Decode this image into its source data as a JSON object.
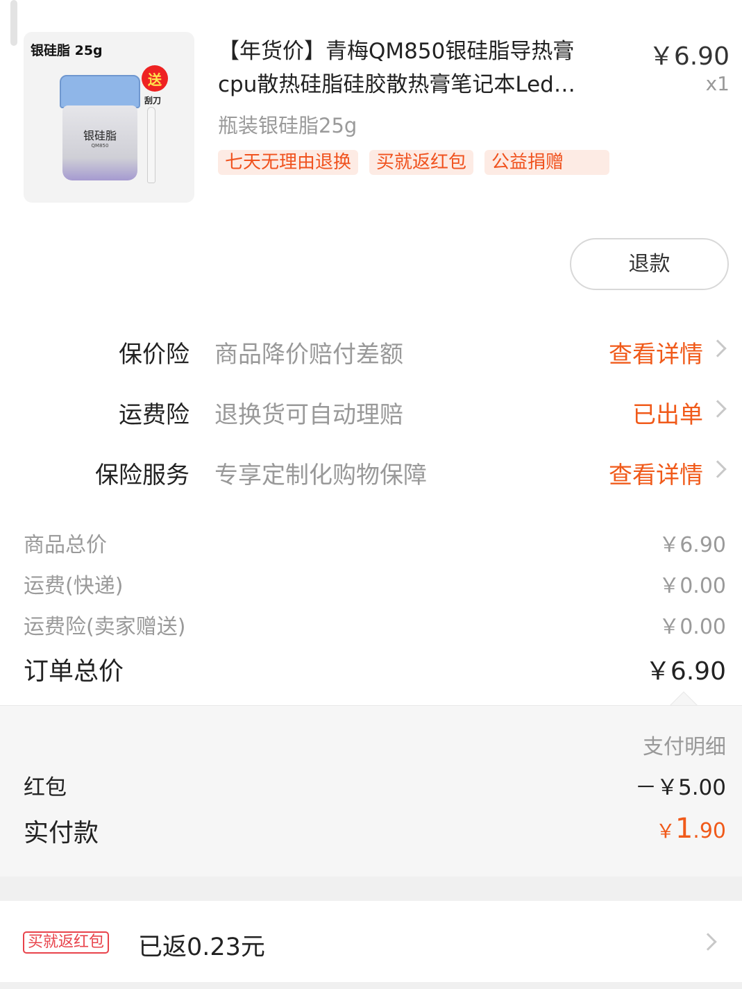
{
  "product": {
    "image_title": "银硅脂 25g",
    "image_jar_label": "银硅脂",
    "image_jar_model": "QM850",
    "image_badge": "送",
    "image_badge_sub": "刮刀",
    "title_line1": "【年货价】青梅QM850银硅脂导热膏",
    "title_line2": "cpu散热硅脂硅胶散热膏笔记本Led…",
    "price": "￥6.90",
    "quantity": "x1",
    "spec": "瓶装银硅脂25g",
    "tags": [
      "七天无理由退换",
      "买就返红包",
      "公益捐赠"
    ]
  },
  "refund_button": "退款",
  "insurance": [
    {
      "label": "保价险",
      "desc": "商品降价赔付差额",
      "action": "查看详情"
    },
    {
      "label": "运费险",
      "desc": "退换货可自动理赔",
      "action": "已出单"
    },
    {
      "label": "保险服务",
      "desc": "专享定制化购物保障",
      "action": "查看详情"
    }
  ],
  "summary": {
    "items_total_label": "商品总价",
    "items_total_value": "￥6.90",
    "shipping_label": "运费(快递)",
    "shipping_value": "￥0.00",
    "shipping_ins_label": "运费险(卖家赠送)",
    "shipping_ins_value": "￥0.00",
    "order_total_label": "订单总价",
    "order_total_value": "￥6.90"
  },
  "payment": {
    "header": "支付明细",
    "redpacket_label": "红包",
    "redpacket_value": "－￥5.00",
    "paid_label": "实付款",
    "paid_currency": "￥",
    "paid_int": "1",
    "paid_dec": ".90"
  },
  "cashback": {
    "tag": "买就返红包",
    "text": "已返0.23元"
  },
  "colors": {
    "accent": "#f05a1a",
    "tag_bg": "#fdebe4",
    "cashback_red": "#e8424a"
  }
}
